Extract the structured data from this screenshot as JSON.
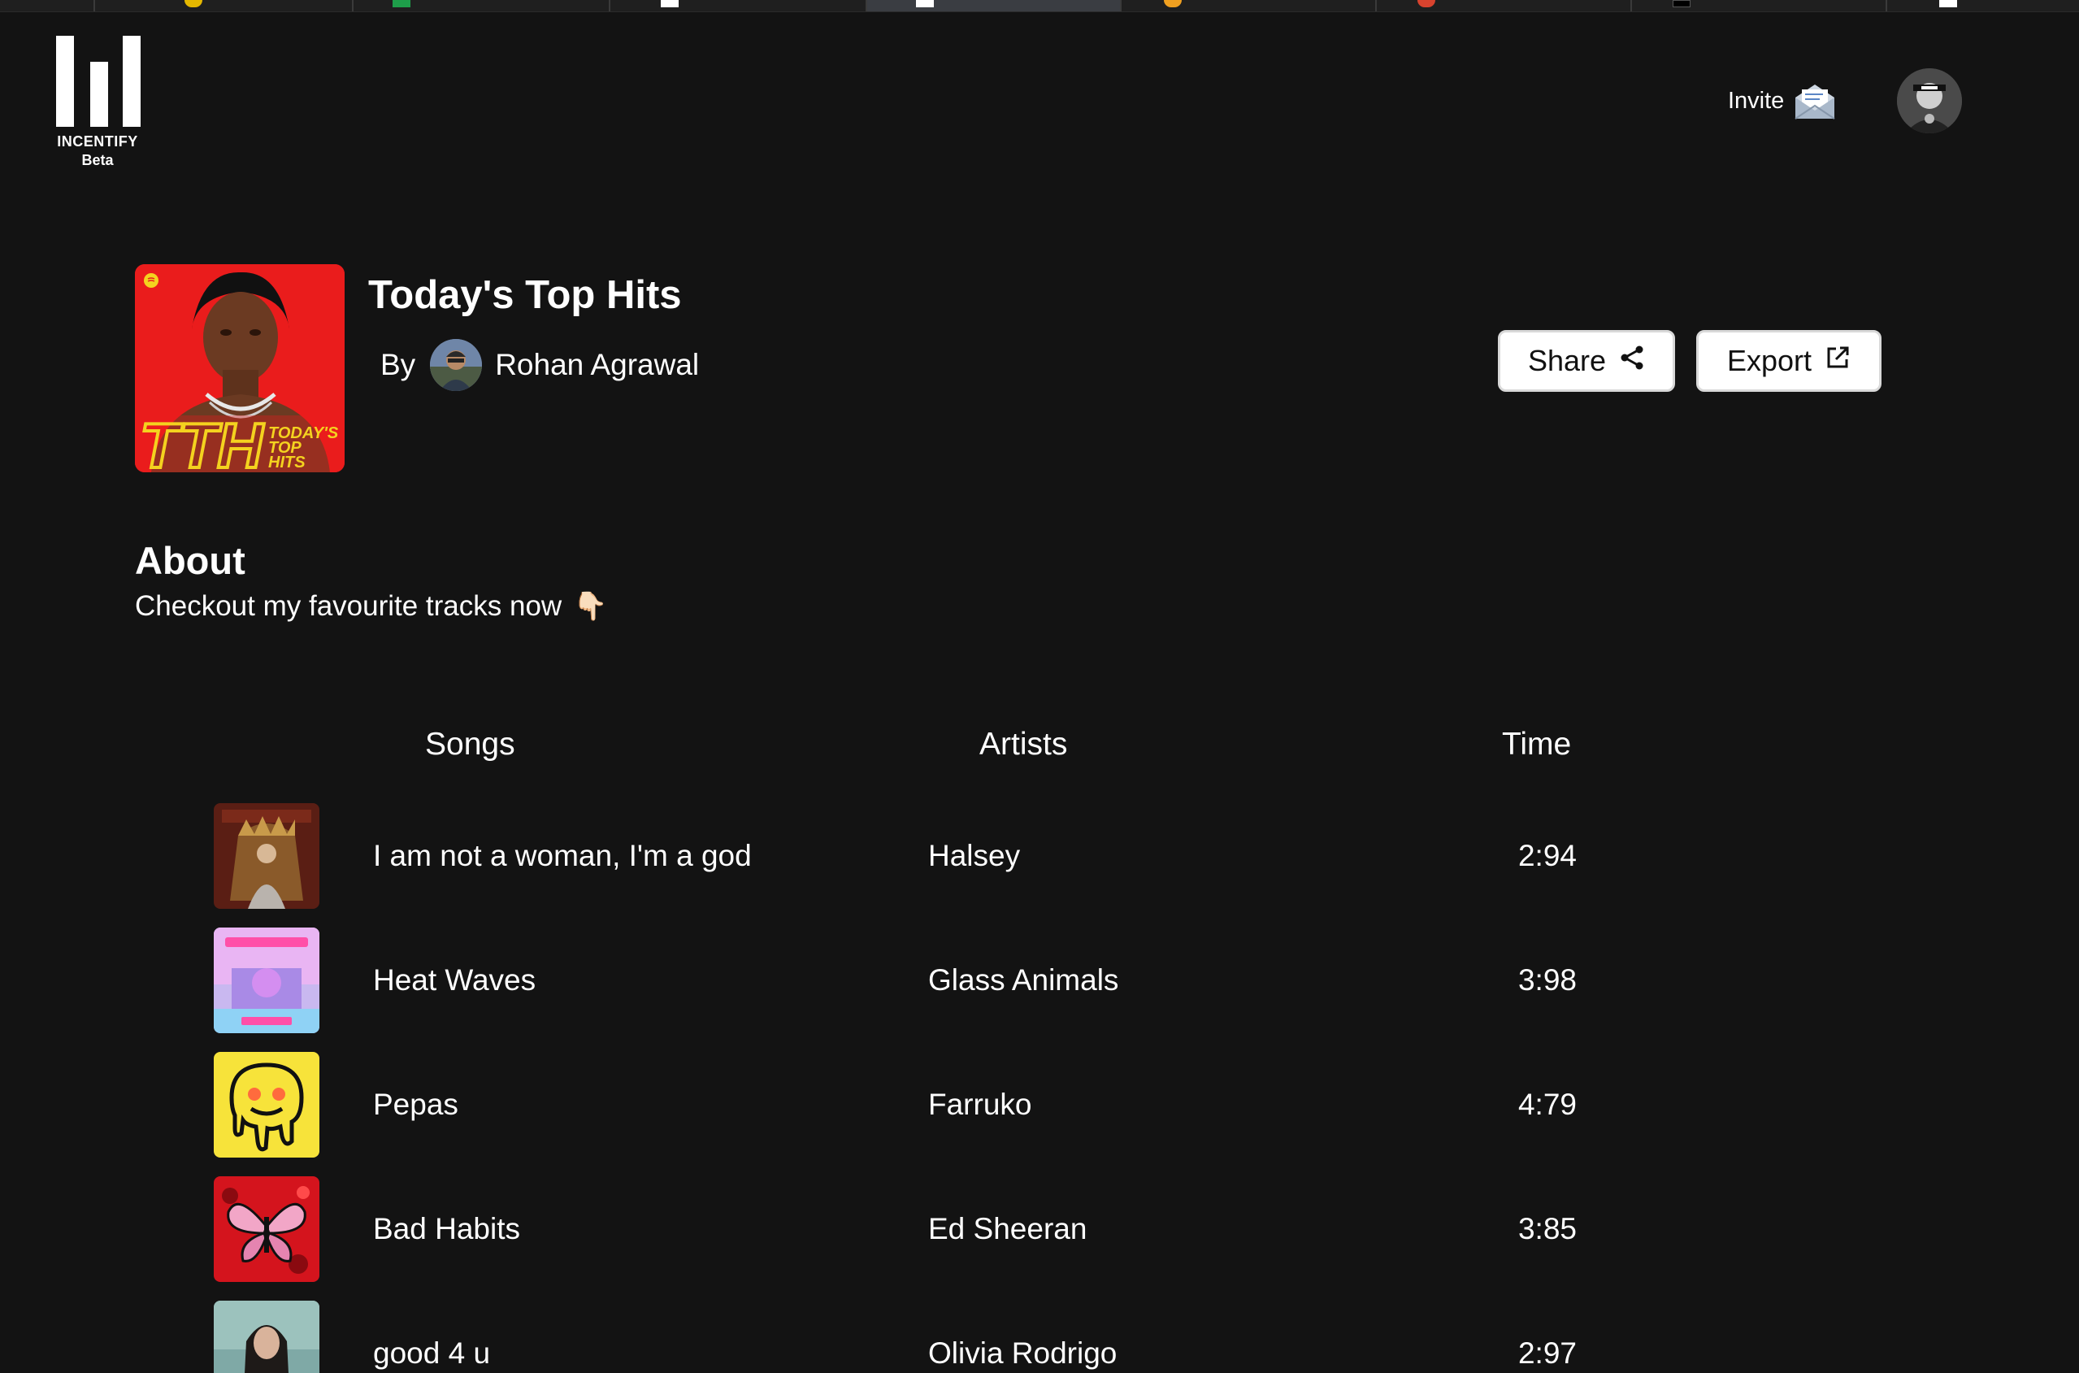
{
  "brand": {
    "name": "INCENTIFY",
    "tag": "Beta"
  },
  "header": {
    "invite_label": "Invite"
  },
  "playlist": {
    "title": "Today's Top Hits",
    "by_label": "By",
    "author": "Rohan Agrawal",
    "cover_lettering": "TODAY'S TOP HITS"
  },
  "actions": {
    "share_label": "Share",
    "export_label": "Export"
  },
  "about": {
    "heading": "About",
    "text": "Checkout my favourite tracks now",
    "emoji": "👇🏻"
  },
  "table": {
    "headers": {
      "songs": "Songs",
      "artists": "Artists",
      "time": "Time"
    },
    "rows": [
      {
        "song": "I am not a woman, I'm a god",
        "artist": "Halsey",
        "time": "2:94",
        "art": "throne-cover"
      },
      {
        "song": "Heat Waves",
        "artist": "Glass Animals",
        "time": "3:98",
        "art": "dreamland-cover"
      },
      {
        "song": "Pepas",
        "artist": "Farruko",
        "time": "4:79",
        "art": "melting-smiley-cover"
      },
      {
        "song": "Bad Habits",
        "artist": "Ed Sheeran",
        "time": "3:85",
        "art": "butterfly-cover"
      },
      {
        "song": "good 4 u",
        "artist": "Olivia Rodrigo",
        "time": "2:97",
        "art": "portrait-cover"
      }
    ]
  },
  "colors": {
    "background": "#131313",
    "text": "#ffffff",
    "button_bg": "#ffffff",
    "cover_red": "#ea1c1c",
    "cover_yellow": "#f4d21f"
  }
}
